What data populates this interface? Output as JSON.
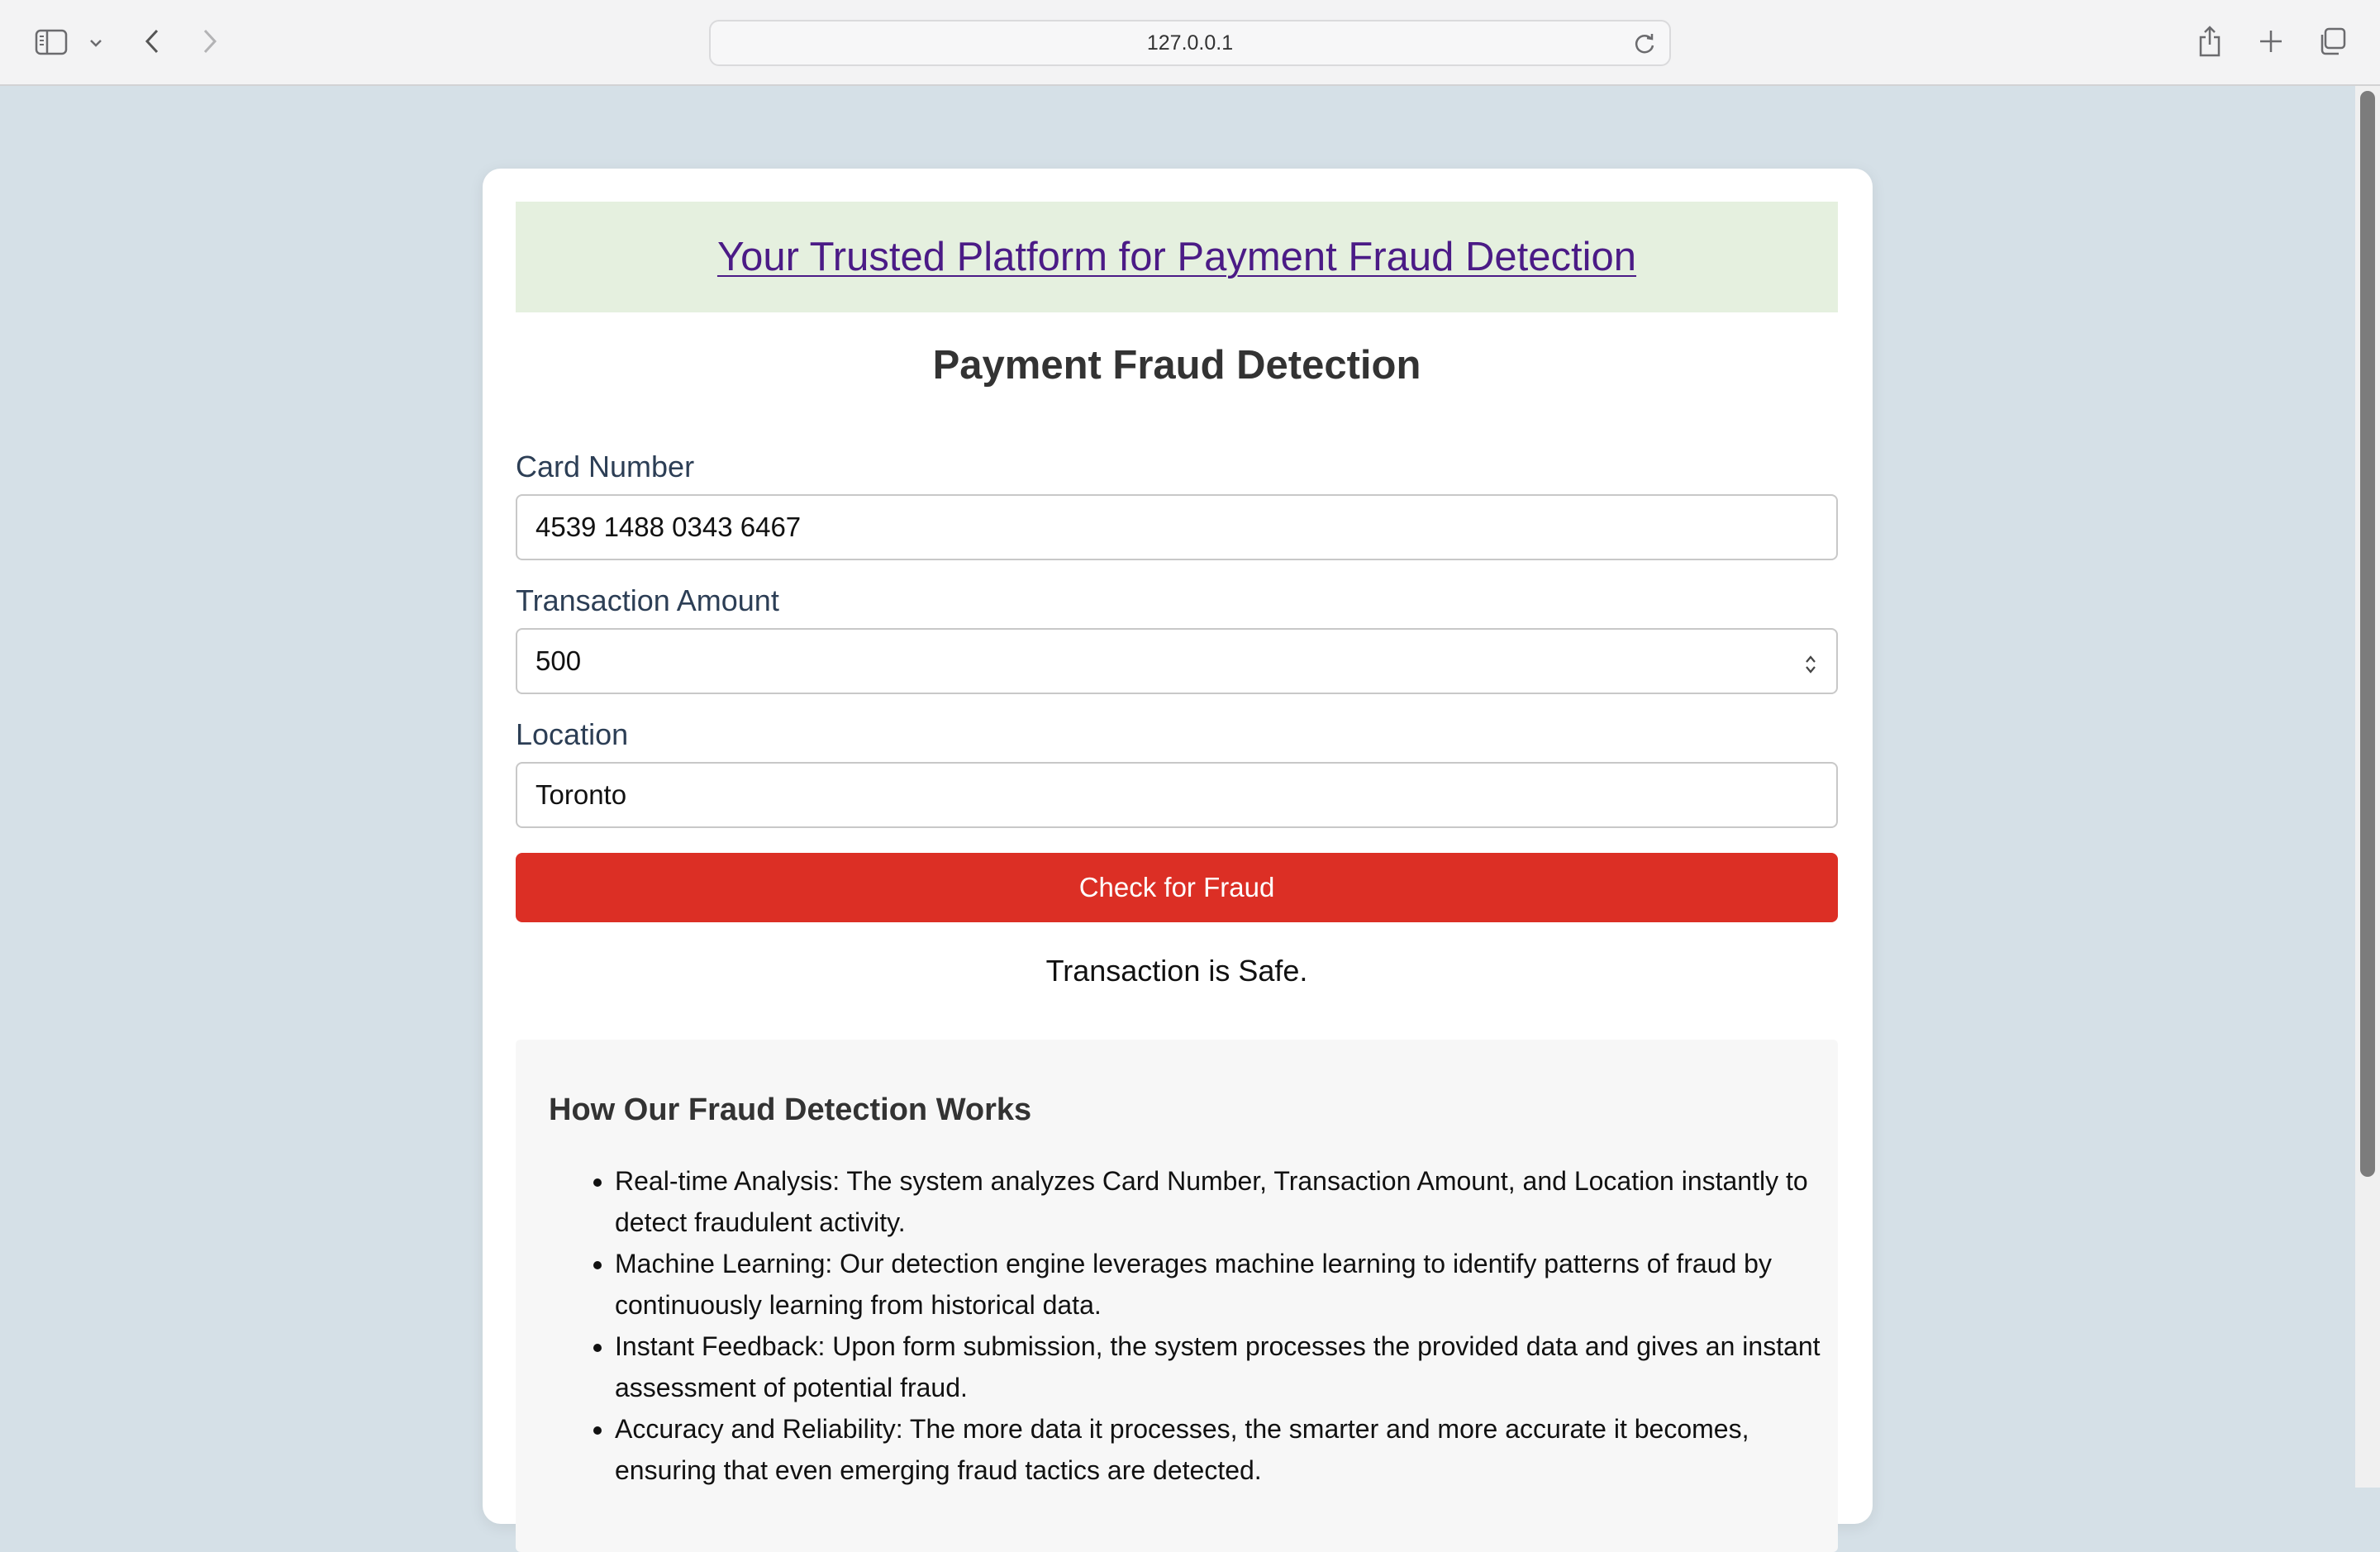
{
  "browser": {
    "url": "127.0.0.1"
  },
  "page": {
    "banner_link": "Your Trusted Platform for Payment Fraud Detection",
    "title": "Payment Fraud Detection",
    "form": {
      "card_label": "Card Number",
      "card_value": "4539 1488 0343 6467",
      "amount_label": "Transaction Amount",
      "amount_value": "500",
      "location_label": "Location",
      "location_value": "Toronto",
      "submit_label": "Check for Fraud"
    },
    "result": "Transaction is Safe.",
    "info": {
      "heading": "How Our Fraud Detection Works",
      "items": [
        "Real-time Analysis: The system analyzes Card Number, Transaction Amount, and Location instantly to detect fraudulent activity.",
        "Machine Learning: Our detection engine leverages machine learning to identify patterns of fraud by continuously learning from historical data.",
        "Instant Feedback: Upon form submission, the system processes the provided data and gives an instant assessment of potential fraud.",
        "Accuracy and Reliability: The more data it processes, the smarter and more accurate it becomes, ensuring that even emerging fraud tactics are detected."
      ]
    }
  },
  "icons": {
    "sidebar": "sidebar-icon",
    "sidebar_menu": "chevron-down-icon",
    "back": "back-arrow-icon",
    "forward": "forward-arrow-icon",
    "reload": "reload-icon",
    "share": "share-icon",
    "new_tab": "plus-icon",
    "tabs": "tab-overview-icon"
  },
  "colors": {
    "page_bg": "#d5e0e7",
    "banner_bg": "#e5f0df",
    "link": "#4b1b86",
    "button": "#dc2f25"
  }
}
